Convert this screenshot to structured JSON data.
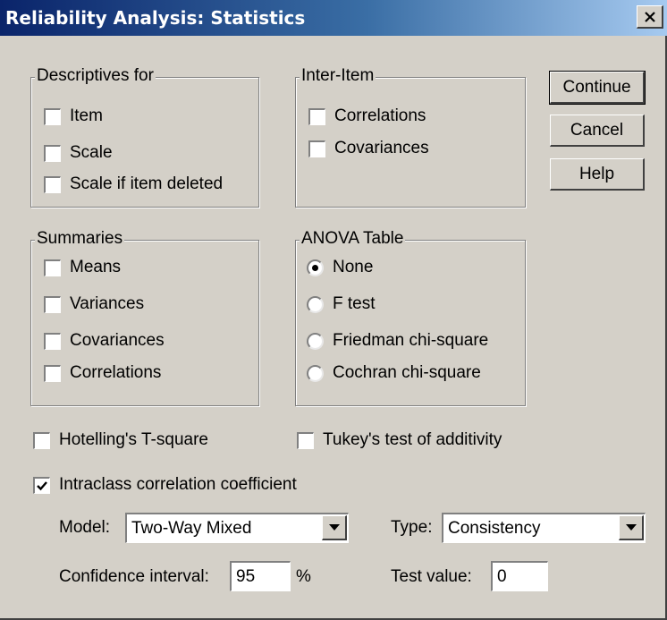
{
  "window": {
    "title": "Reliability Analysis: Statistics",
    "close_glyph": "✕"
  },
  "descriptives": {
    "legend": "Descriptives for",
    "items": [
      "Item",
      "Scale",
      "Scale if item deleted"
    ],
    "checked": [
      false,
      false,
      false
    ]
  },
  "inter_item": {
    "legend": "Inter-Item",
    "items": [
      "Correlations",
      "Covariances"
    ],
    "checked": [
      false,
      false
    ]
  },
  "summaries": {
    "legend": "Summaries",
    "items": [
      "Means",
      "Variances",
      "Covariances",
      "Correlations"
    ],
    "checked": [
      false,
      false,
      false,
      false
    ]
  },
  "anova": {
    "legend": "ANOVA Table",
    "options": [
      "None",
      "F test",
      "Friedman chi-square",
      "Cochran chi-square"
    ],
    "selected": "None"
  },
  "buttons": {
    "continue": "Continue",
    "cancel": "Cancel",
    "help": "Help"
  },
  "hotelling": {
    "label": "Hotelling's T-square",
    "checked": false
  },
  "tukey": {
    "label": "Tukey's test of additivity",
    "checked": false
  },
  "icc": {
    "label": "Intraclass correlation coefficient",
    "checked": true,
    "model_label": "Model:",
    "model_value": "Two-Way Mixed",
    "type_label": "Type:",
    "type_value": "Consistency",
    "ci_label": "Confidence interval:",
    "ci_value": "95",
    "ci_unit": "%",
    "test_label": "Test value:",
    "test_value": "0"
  },
  "colors": {
    "face": "#d4d0c8",
    "title_start": "#0a246a",
    "title_end": "#a6caf0"
  }
}
